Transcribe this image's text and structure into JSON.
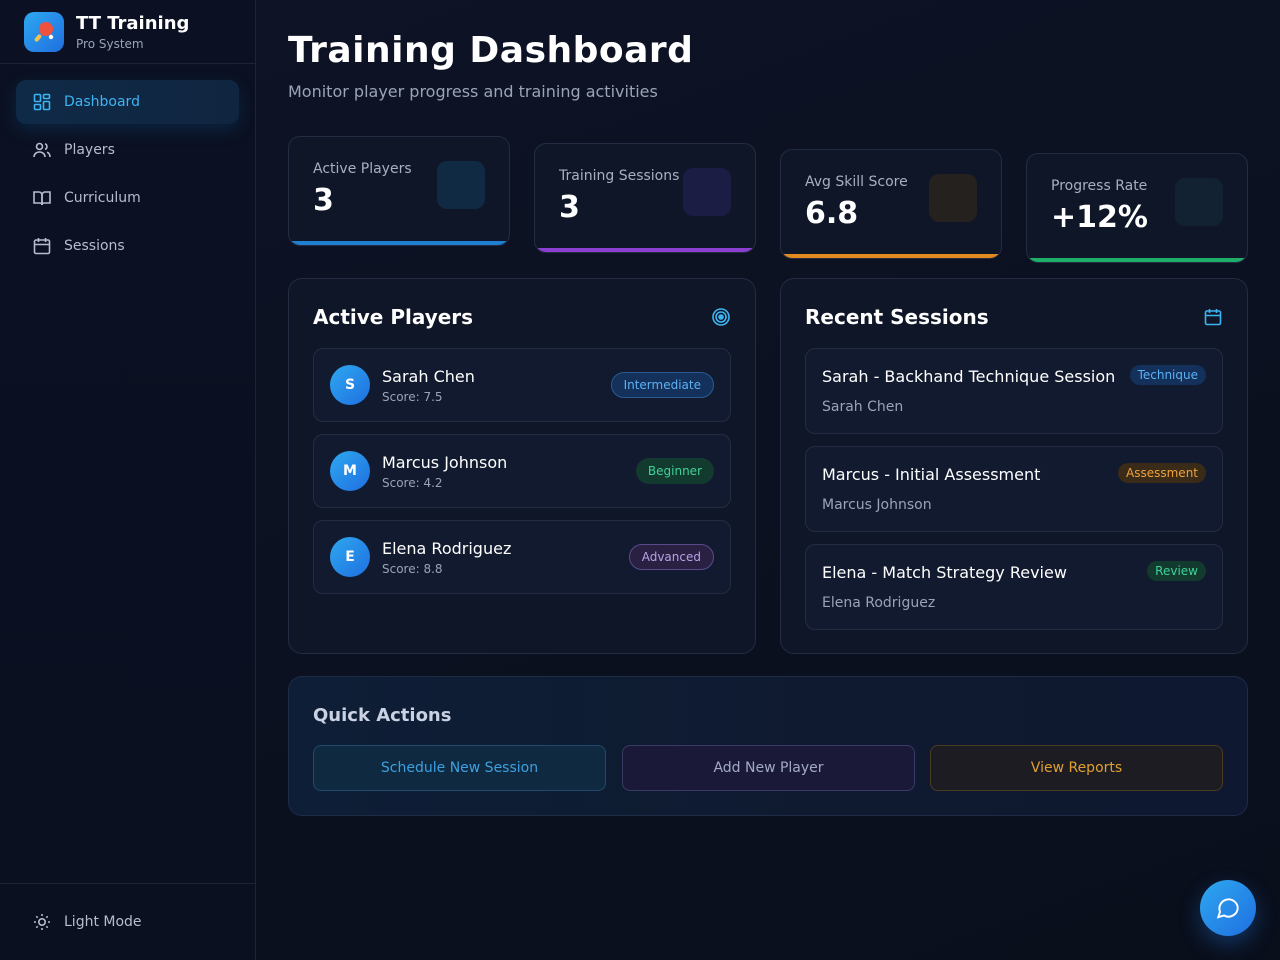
{
  "brand": {
    "title": "TT Training",
    "subtitle": "Pro System"
  },
  "sidebar": {
    "items": [
      {
        "label": "Dashboard",
        "icon": "dashboard-icon",
        "active": true
      },
      {
        "label": "Players",
        "icon": "users-icon",
        "active": false
      },
      {
        "label": "Curriculum",
        "icon": "book-icon",
        "active": false
      },
      {
        "label": "Sessions",
        "icon": "calendar-icon",
        "active": false
      }
    ],
    "theme_toggle": {
      "label": "Light Mode",
      "icon": "sun-icon"
    }
  },
  "header": {
    "title": "Training Dashboard",
    "subtitle": "Monitor player progress and training activities"
  },
  "stats": [
    {
      "label": "Active Players",
      "value": "3",
      "accent": "#1f7fd0"
    },
    {
      "label": "Training Sessions",
      "value": "3",
      "accent": "#8a3fd0"
    },
    {
      "label": "Avg Skill Score",
      "value": "6.8",
      "accent": "#e08a1f"
    },
    {
      "label": "Progress Rate",
      "value": "+12%",
      "accent": "#1fae6a"
    }
  ],
  "players_panel": {
    "title": "Active Players",
    "icon": "target-icon",
    "players": [
      {
        "initial": "S",
        "name": "Sarah Chen",
        "score": "Score: 7.5",
        "level": "Intermediate"
      },
      {
        "initial": "M",
        "name": "Marcus Johnson",
        "score": "Score: 4.2",
        "level": "Beginner"
      },
      {
        "initial": "E",
        "name": "Elena Rodriguez",
        "score": "Score: 8.8",
        "level": "Advanced"
      }
    ]
  },
  "sessions_panel": {
    "title": "Recent Sessions",
    "icon": "calendar-icon",
    "sessions": [
      {
        "title": "Sarah - Backhand Technique Session",
        "player": "Sarah Chen",
        "tag": "Technique"
      },
      {
        "title": "Marcus - Initial Assessment",
        "player": "Marcus Johnson",
        "tag": "Assessment"
      },
      {
        "title": "Elena - Match Strategy Review",
        "player": "Elena Rodriguez",
        "tag": "Review"
      }
    ]
  },
  "quick_actions": {
    "title": "Quick Actions",
    "buttons": [
      {
        "label": "Schedule New Session"
      },
      {
        "label": "Add New Player"
      },
      {
        "label": "View Reports"
      }
    ]
  },
  "chat_button": {
    "icon": "chat-icon"
  }
}
